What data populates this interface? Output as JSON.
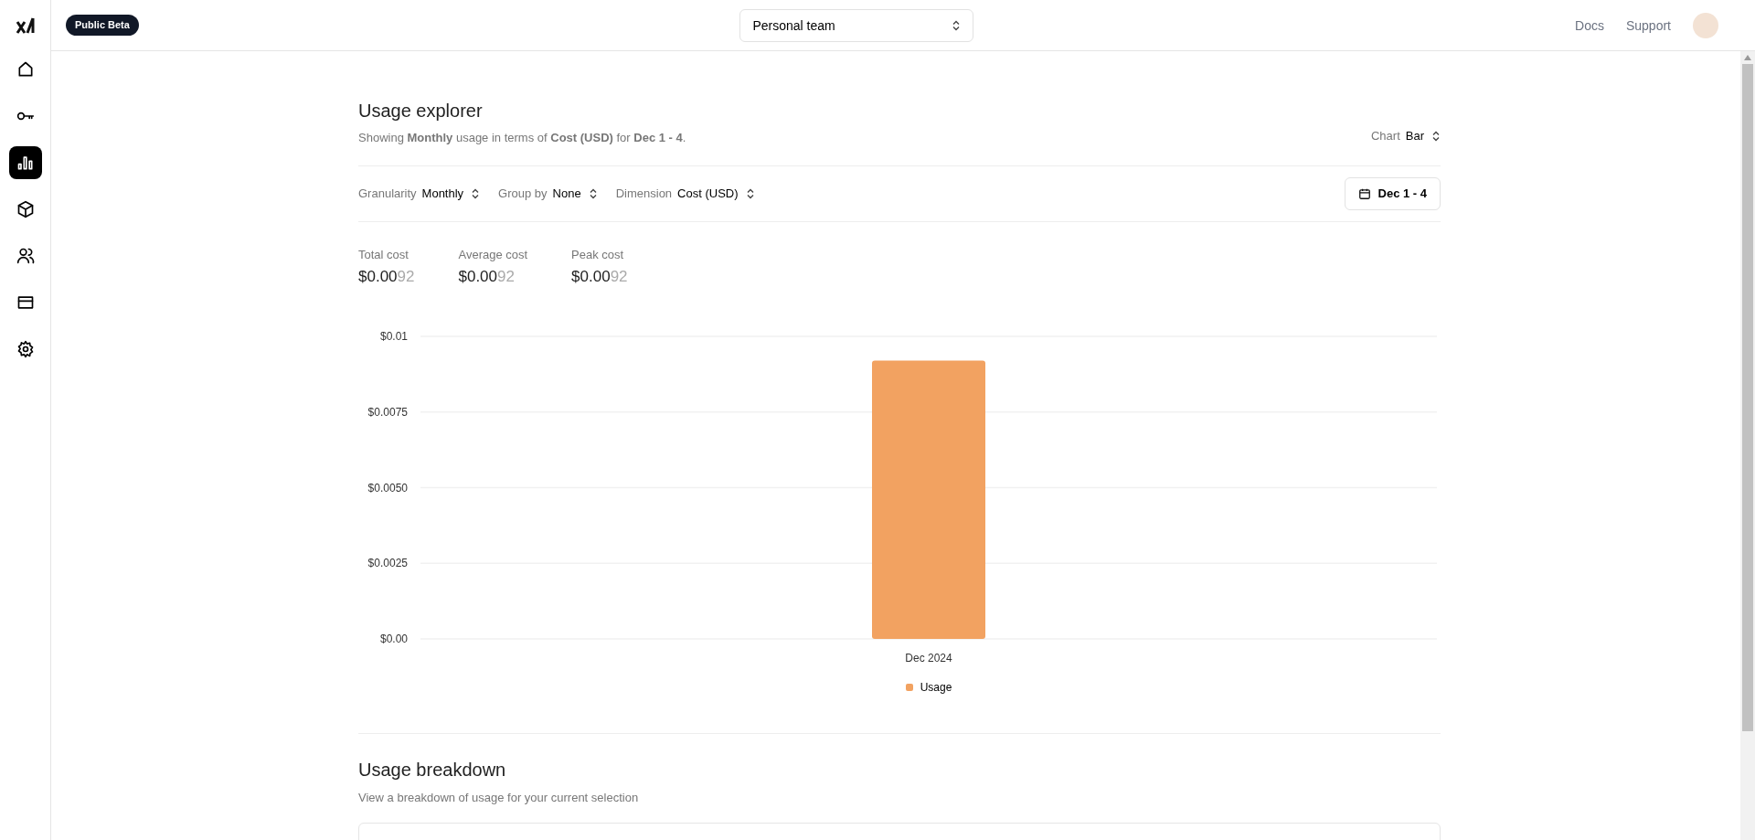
{
  "sidebar": {
    "items": [
      {
        "kind": "home",
        "selected": false
      },
      {
        "kind": "key",
        "selected": false
      },
      {
        "kind": "usage",
        "selected": true
      },
      {
        "kind": "box",
        "selected": false
      },
      {
        "kind": "users",
        "selected": false
      },
      {
        "kind": "billing",
        "selected": false
      },
      {
        "kind": "settings",
        "selected": false
      }
    ]
  },
  "topbar": {
    "badge": "Public Beta",
    "team_selector": "Personal team",
    "links": [
      "Docs",
      "Support"
    ]
  },
  "usage_explorer": {
    "title": "Usage explorer",
    "subtitle": "Showing **Monthly** usage in terms of **Cost (USD)** for **Dec 1 - 4**.",
    "chart_type": {
      "label": "Chart",
      "value": "Bar"
    },
    "filters": [
      {
        "label": "Granularity",
        "value": "Monthly"
      },
      {
        "label": "Group by",
        "value": "None"
      },
      {
        "label": "Dimension",
        "value": "Cost (USD)"
      }
    ],
    "date_range": "Dec 1 - 4",
    "metrics": [
      {
        "label": "Total cost",
        "value": "$0.00",
        "value_tail": "92"
      },
      {
        "label": "Average cost",
        "value": "$0.00",
        "value_tail": "92"
      },
      {
        "label": "Peak cost",
        "value": "$0.00",
        "value_tail": "92"
      }
    ],
    "chart_data": {
      "type": "bar",
      "grid": true,
      "categories": [
        "Dec 2024"
      ],
      "series": [
        {
          "name": "Usage",
          "color": "#f2a261",
          "values": [
            0.0092
          ]
        }
      ],
      "ylim": [
        0,
        0.01
      ],
      "yticks": [
        {
          "value": 0,
          "label": "$0.00"
        },
        {
          "value": 0.0025,
          "label": "$0.0025"
        },
        {
          "value": 0.005,
          "label": "$0.0050"
        },
        {
          "value": 0.0075,
          "label": "$0.0075"
        },
        {
          "value": 0.01,
          "label": "$0.01"
        }
      ]
    }
  },
  "usage_breakdown": {
    "title": "Usage breakdown",
    "subtitle": "View a breakdown of usage for your current selection"
  }
}
